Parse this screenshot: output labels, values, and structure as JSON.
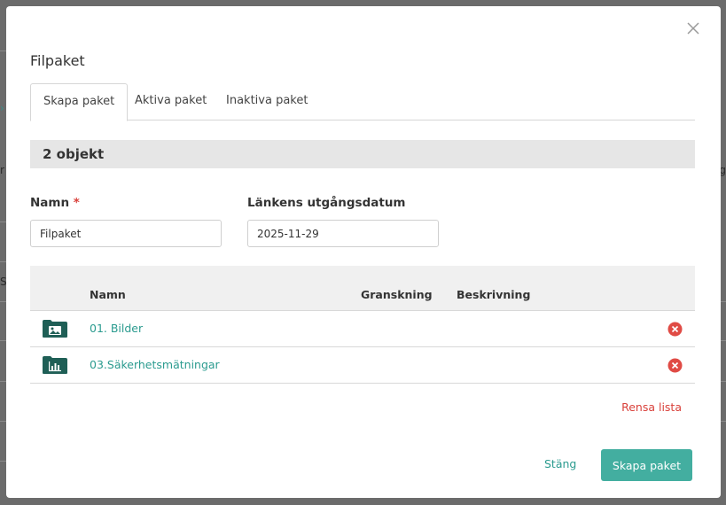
{
  "modal": {
    "title": "Filpaket"
  },
  "tabs": [
    {
      "label": "Skapa paket",
      "active": true
    },
    {
      "label": "Aktiva paket",
      "active": false
    },
    {
      "label": "Inaktiva paket",
      "active": false
    }
  ],
  "summary": {
    "count_label": "2 objekt"
  },
  "form": {
    "name_label": "Namn",
    "required_marker": "*",
    "name_value": "Filpaket",
    "expiry_label": "Länkens utgångsdatum",
    "expiry_value": "2025-11-29"
  },
  "table": {
    "headers": {
      "name": "Namn",
      "review": "Granskning",
      "description": "Beskrivning"
    },
    "rows": [
      {
        "name": "01. Bilder",
        "icon": "image-folder-icon"
      },
      {
        "name": "03.Säkerhetsmätningar",
        "icon": "chart-folder-icon"
      }
    ]
  },
  "actions": {
    "clear_list": "Rensa lista",
    "close": "Stäng",
    "create_package": "Skapa paket"
  },
  "colors": {
    "accent": "#43aea0",
    "link": "#2b9b8f",
    "danger": "#d9413b",
    "folder": "#1f5f56"
  }
}
